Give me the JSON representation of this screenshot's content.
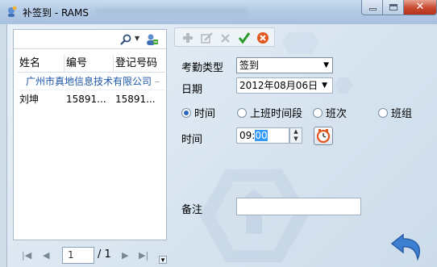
{
  "window": {
    "title": "补签到 - RAMS",
    "close_glyph": "✕"
  },
  "left_panel": {
    "search": {
      "value": "",
      "placeholder": ""
    },
    "columns": [
      "姓名",
      "编号",
      "登记号码"
    ],
    "group": {
      "label": "广州市真地信息技术有限公司",
      "suffix": "–"
    },
    "rows": [
      {
        "name": "刘坤",
        "number": "15891...",
        "reg_no": "15891..."
      }
    ]
  },
  "pager": {
    "first": "|◀",
    "prev": "◀",
    "current": "1",
    "total": "/ 1",
    "next": "▶",
    "last": "▶|"
  },
  "toolbar": {
    "icons": [
      "add-icon",
      "edit-icon",
      "delete-icon",
      "confirm-icon",
      "cancel-icon"
    ]
  },
  "form": {
    "attendance_type": {
      "label": "考勤类型",
      "value": "签到"
    },
    "date": {
      "label": "日期",
      "value": "2012年08月06日"
    },
    "radios": [
      {
        "label": "时间",
        "selected": true
      },
      {
        "label": "上班时间段",
        "selected": false
      },
      {
        "label": "班次",
        "selected": false
      },
      {
        "label": "班组",
        "selected": false
      }
    ],
    "time": {
      "label": "时间",
      "hour": "09:",
      "minute": "00"
    },
    "note": {
      "label": "备注",
      "value": ""
    }
  },
  "colors": {
    "accent": "#2a69c0",
    "group_text": "#1c56a8",
    "close_red": "#c7472f",
    "confirm_green": "#2e9a2e",
    "cancel_orange": "#e2561f"
  }
}
